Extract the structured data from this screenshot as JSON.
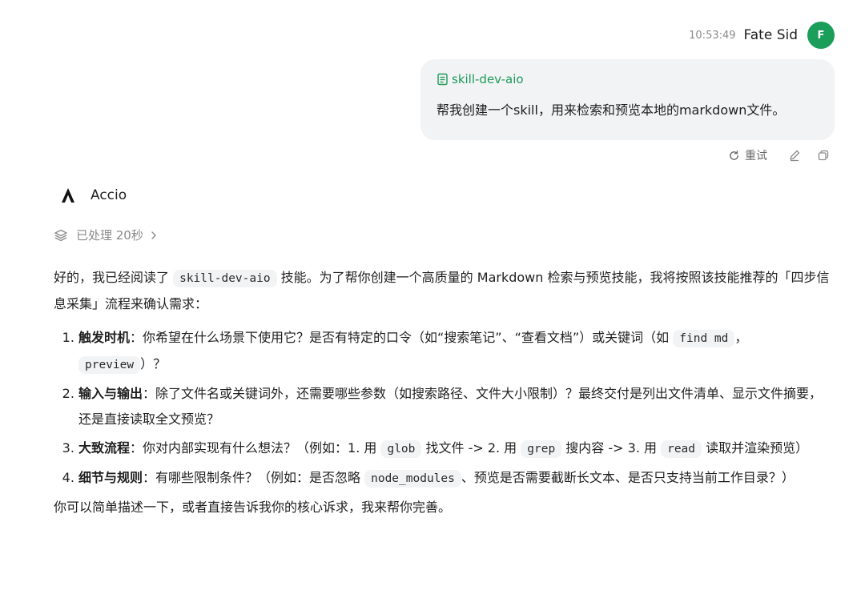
{
  "user": {
    "time": "10:53:49",
    "name": "Fate Sid",
    "avatar_letter": "F",
    "avatar_color": "#1b9e5a",
    "skill_tag": "skill-dev-aio",
    "message": "帮我创建一个skill，用来检索和预览本地的markdown文件。",
    "actions": {
      "retry_label": "重试"
    }
  },
  "assistant": {
    "name": "Accio",
    "processed_label": "已处理 20秒",
    "intro": {
      "before": "好的，我已经阅读了 ",
      "code": "skill-dev-aio",
      "after": " 技能。为了帮你创建一个高质量的 Markdown 检索与预览技能，我将按照该技能推荐的「四步信息采集」流程来确认需求："
    },
    "steps": [
      {
        "title": "触发时机",
        "text_1": "：你希望在什么场景下使用它？是否有特定的口令（如“搜索笔记”、“查看文档”）或关键词（如 ",
        "code_1": "find md",
        "sep": "，",
        "code_2": "preview",
        "text_2": "）？"
      },
      {
        "title": "输入与输出",
        "text_1": "：除了文件名或关键词外，还需要哪些参数（如搜索路径、文件大小限制）？最终交付是列出文件清单、显示文件摘要，还是直接读取全文预览？"
      },
      {
        "title": "大致流程",
        "text_1": "：你对内部实现有什么想法？（例如：1. 用 ",
        "code_1": "glob",
        "text_2": " 找文件 -> 2. 用 ",
        "code_2": "grep",
        "text_3": " 搜内容 -> 3. 用 ",
        "code_3": "read",
        "text_4": " 读取并渲染预览）"
      },
      {
        "title": "细节与规则",
        "text_1": "：有哪些限制条件？（例如：是否忽略 ",
        "code_1": "node_modules",
        "text_2": "、预览是否需要截断长文本、是否只支持当前工作目录？）"
      }
    ],
    "outro": "你可以简单描述一下，或者直接告诉我你的核心诉求，我来帮你完善。"
  },
  "colors": {
    "accent_green": "#1d9a5b",
    "bubble_bg": "#f2f3f5",
    "muted_text": "#8a8a8a"
  },
  "icons": {
    "skill": "document-icon",
    "retry": "refresh-icon",
    "edit": "pencil-icon",
    "copy": "copy-icon",
    "processed": "layers-icon",
    "expand": "chevron-right-icon"
  }
}
